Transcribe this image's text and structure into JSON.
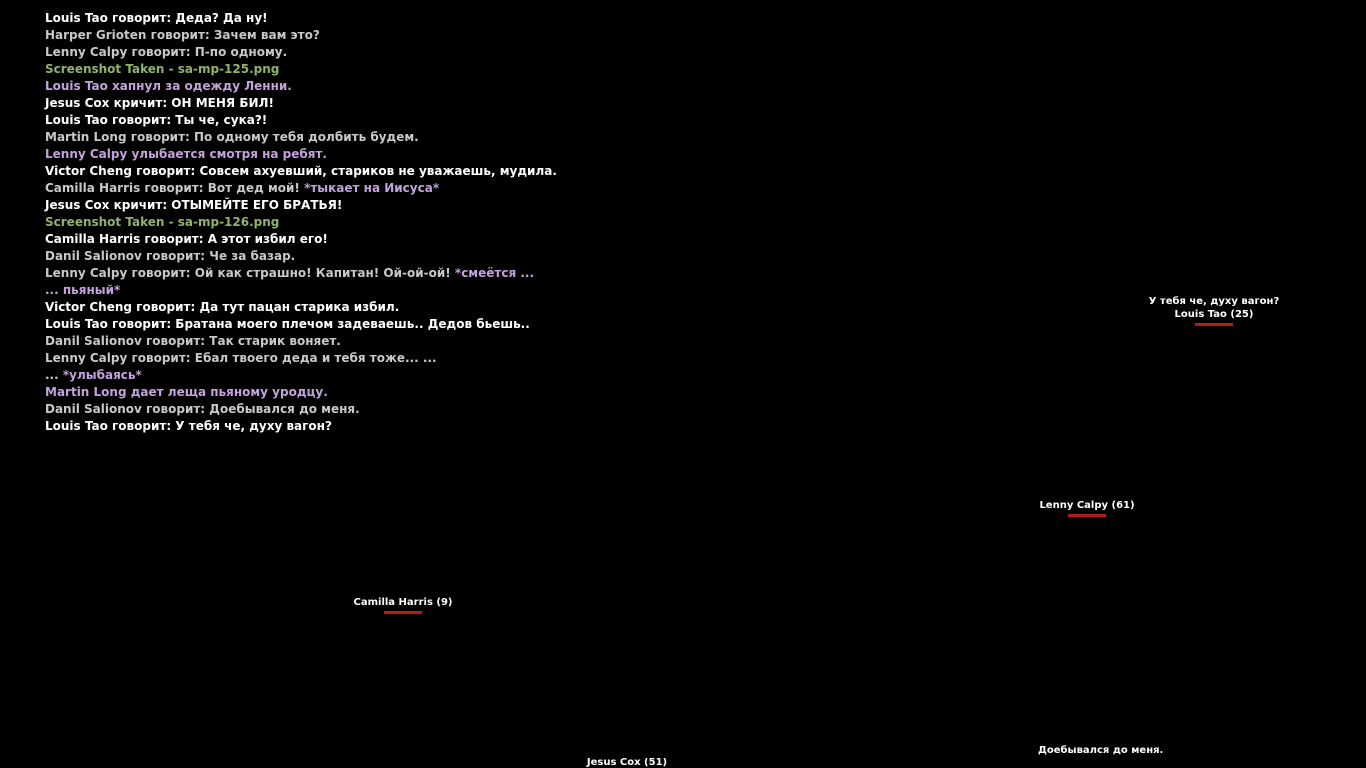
{
  "colors": {
    "white": "#ffffff",
    "gray": "#c8c8c8",
    "green": "#8fb36b",
    "purple": "#c2a2da",
    "health": "#b4191d"
  },
  "chat": [
    [
      {
        "t": "Louis Tao говорит: Деда? Да ну!",
        "c": "white"
      }
    ],
    [
      {
        "t": "Harper Grioten говорит: Зачем вам это?",
        "c": "gray"
      }
    ],
    [
      {
        "t": "Lenny Calpy говорит: П-по одному.",
        "c": "gray"
      }
    ],
    [
      {
        "t": "Screenshot Taken - sa-mp-125.png",
        "c": "green"
      }
    ],
    [
      {
        "t": "Louis Tao хапнул за одежду Ленни.",
        "c": "purple"
      }
    ],
    [
      {
        "t": "Jesus Cox кричит: ОН МЕНЯ БИЛ!",
        "c": "white"
      }
    ],
    [
      {
        "t": "Louis Tao говорит: Ты че, сука?!",
        "c": "white"
      }
    ],
    [
      {
        "t": "Martin Long говорит: По одному тебя долбить будем.",
        "c": "gray"
      }
    ],
    [
      {
        "t": "Lenny Calpy улыбается смотря на ребят.",
        "c": "purple"
      }
    ],
    [
      {
        "t": "Victor Cheng говорит: Совсем ахуевший, стариков не уважаешь, мудила.",
        "c": "white"
      }
    ],
    [
      {
        "t": "Camilla Harris говорит: Вот дед мой! ",
        "c": "gray"
      },
      {
        "t": "*тыкает на Иисуса*",
        "c": "purple"
      }
    ],
    [
      {
        "t": "Jesus Cox кричит: ОТЫМЕЙТЕ ЕГО БРАТЬЯ!",
        "c": "white"
      }
    ],
    [
      {
        "t": "Screenshot Taken - sa-mp-126.png",
        "c": "green"
      }
    ],
    [
      {
        "t": "Camilla Harris говорит: А этот избил его!",
        "c": "white"
      }
    ],
    [
      {
        "t": "Danil Salionov говорит: Че за базар.",
        "c": "gray"
      }
    ],
    [
      {
        "t": "Lenny Calpy говорит: Ой как страшно! Капитан! Ой-ой-ой! ",
        "c": "gray"
      },
      {
        "t": "*смеётся ...",
        "c": "purple"
      }
    ],
    [
      {
        "t": "... пьяный*",
        "c": "purple"
      }
    ],
    [
      {
        "t": "Victor Cheng говорит: Да тут пацан старика избил.",
        "c": "white"
      }
    ],
    [
      {
        "t": "Louis Tao говорит: Братана моего плечом задеваешь.. Дедов бьешь..",
        "c": "white"
      }
    ],
    [
      {
        "t": "Danil Salionov говорит: Так старик воняет.",
        "c": "gray"
      }
    ],
    [
      {
        "t": "Lenny Calpy говорит: Ебал твоего деда и тебя тоже... ...",
        "c": "gray"
      }
    ],
    [
      {
        "t": "... ",
        "c": "gray"
      },
      {
        "t": "*улыбаясь*",
        "c": "purple"
      }
    ],
    [
      {
        "t": "Martin Long дает леща пьяному уродцу.",
        "c": "purple"
      }
    ],
    [
      {
        "t": "Danil Salionov говорит: Доебывался до меня.",
        "c": "gray"
      }
    ],
    [
      {
        "t": "Louis Tao говорит: У тебя че, духу вагон?",
        "c": "white"
      }
    ]
  ],
  "nametags": {
    "louis": {
      "bubble": "У тебя че, духу вагон?",
      "name": "Louis Tao (25)",
      "health_fraction": 1.0
    },
    "lenny": {
      "name": "Lenny Calpy (61)",
      "health_fraction": 1.0
    },
    "camilla": {
      "name": "Camilla Harris (9)",
      "health_fraction": 1.0
    },
    "jesus": {
      "name": "Jesus Cox (51)"
    }
  },
  "floating_text": {
    "danil_bubble": "Доебывался до меня."
  }
}
